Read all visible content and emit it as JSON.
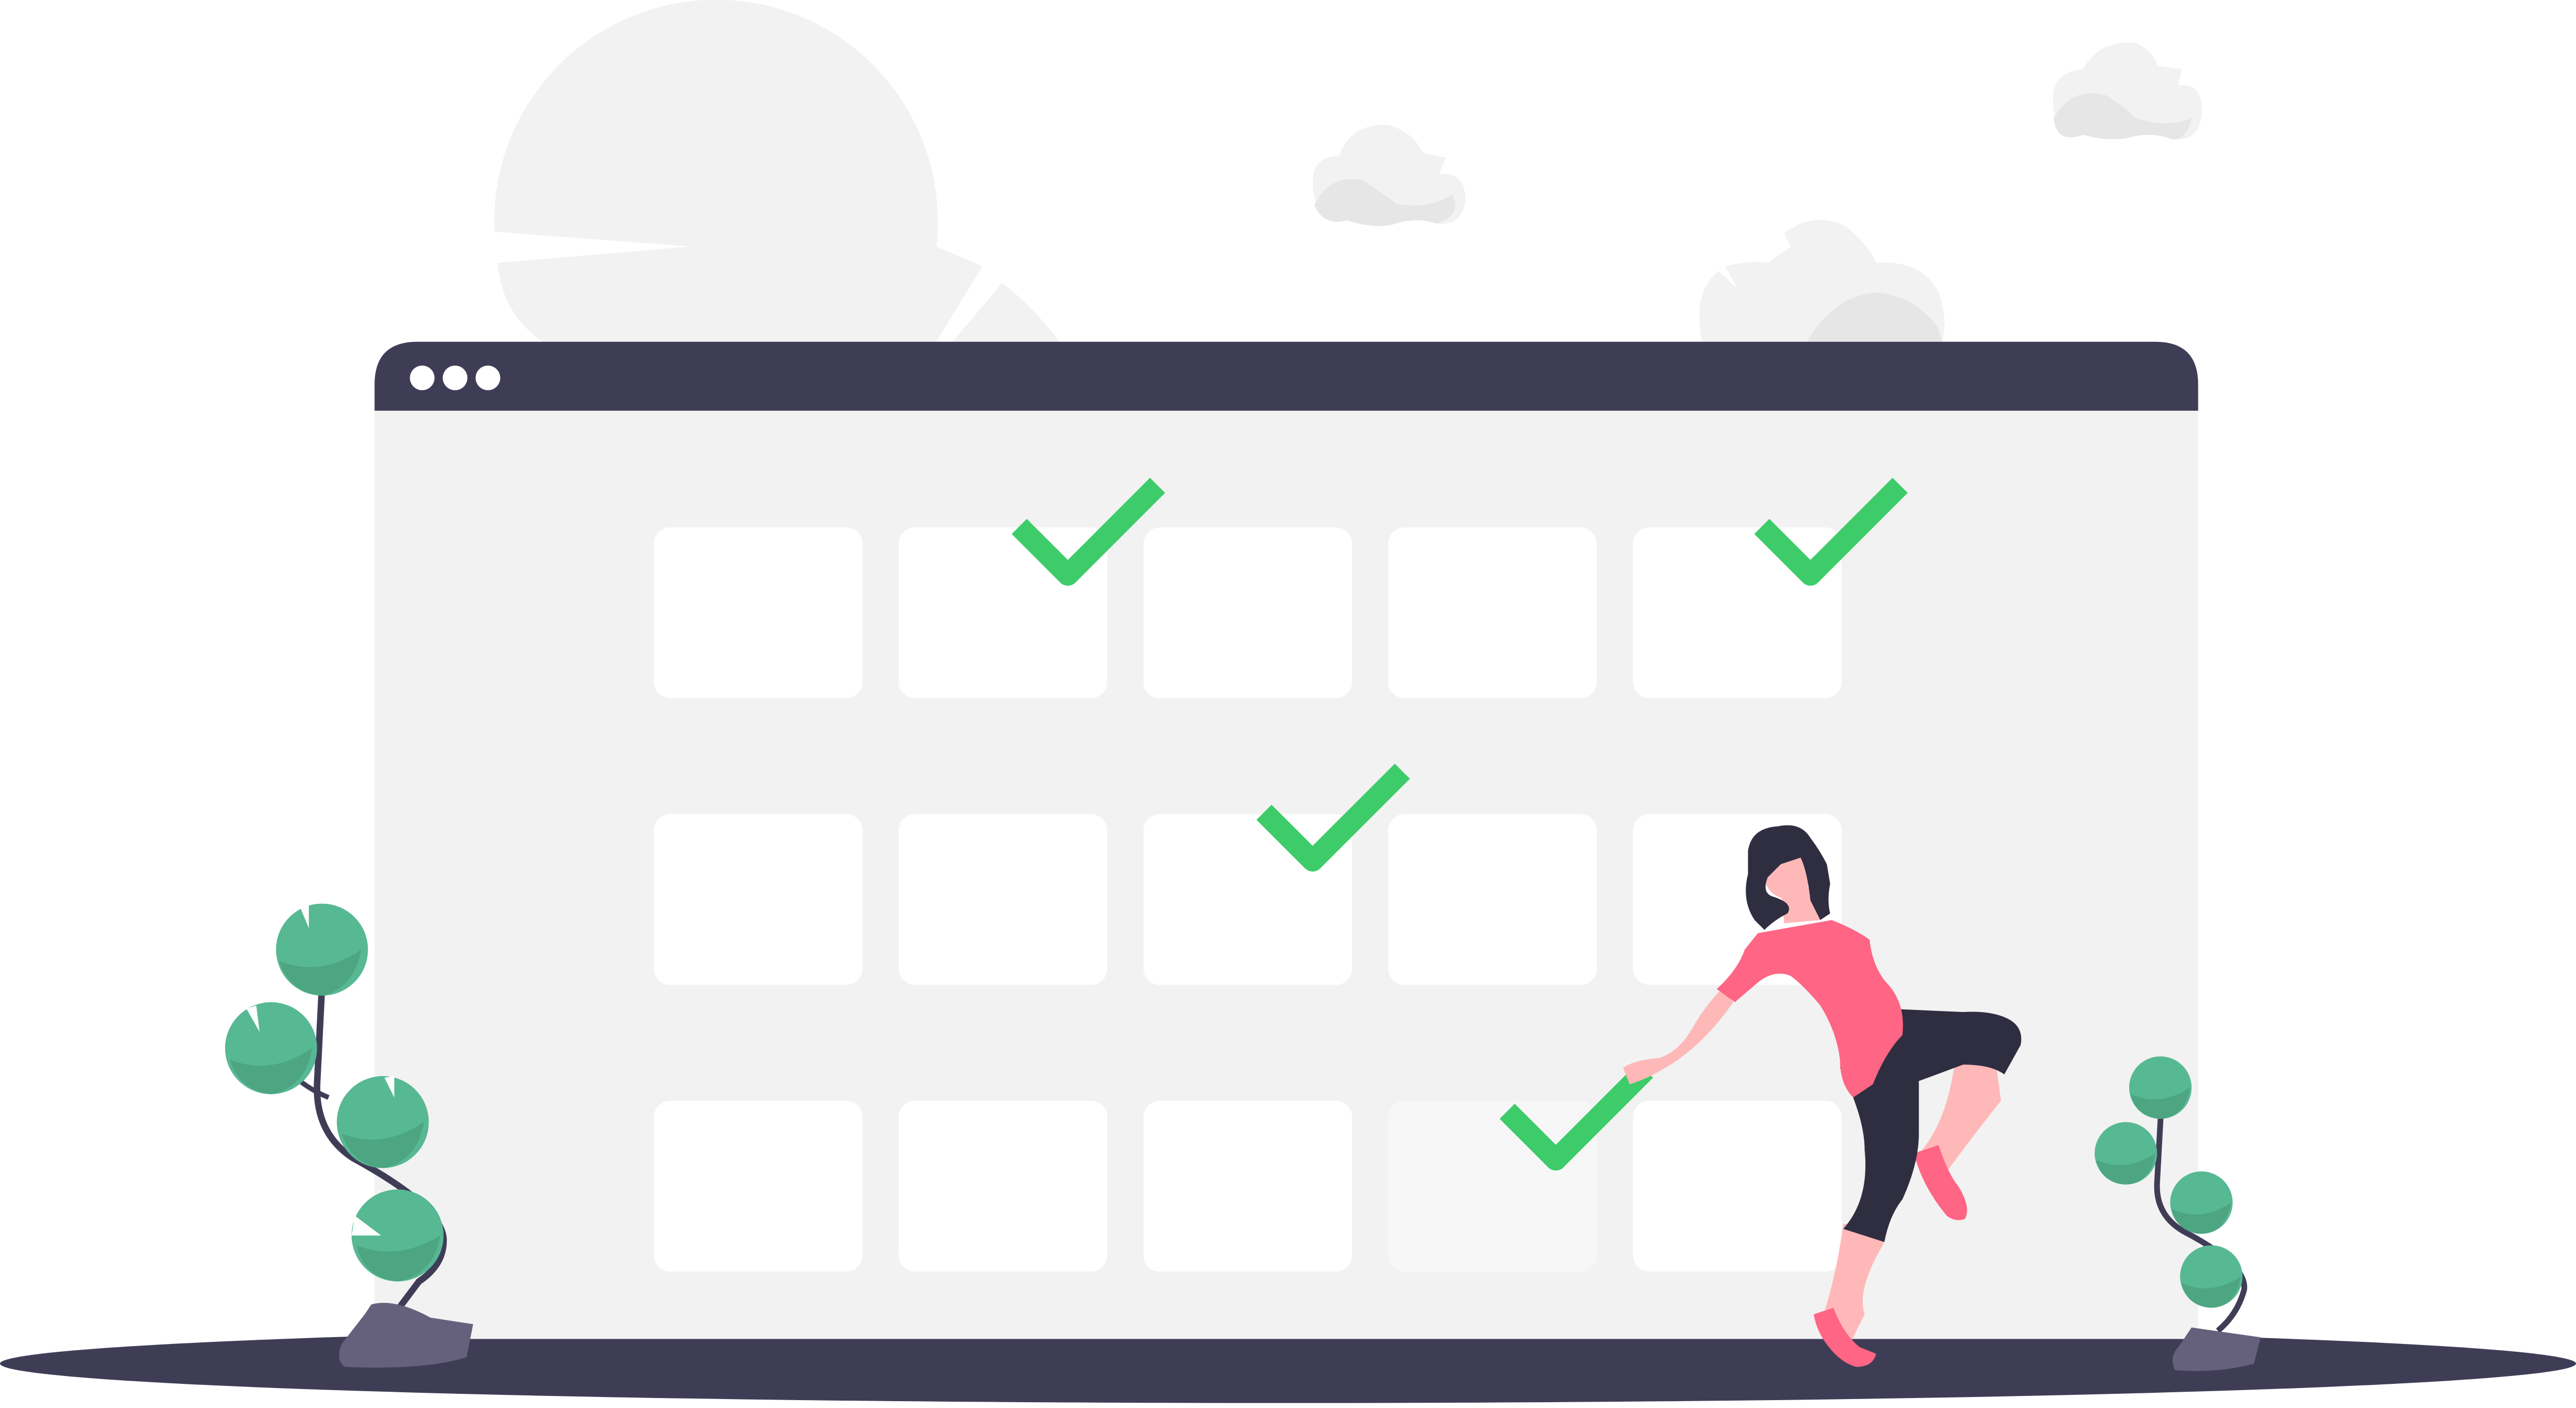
{
  "illustration": {
    "subject": "calendar-schedule",
    "colors": {
      "window_frame": "#3f3d56",
      "window_body": "#f2f2f2",
      "calendar_cell": "#ffffff",
      "calendar_cell_dimmed": "#f7f7f7",
      "window_dot": "#ffffff",
      "check": "#3ecc6b",
      "background_shape": "#f2f2f2",
      "cloud_shadow": "#e6e6e6",
      "ground": "#3f3d56",
      "plant_leaf": "#57b894",
      "plant_leaf_shade": "#4da582",
      "plant_stem": "#3f3d56",
      "plant_pot": "#65617d",
      "person_hair": "#2f2e41",
      "person_skin": "#ffb8b8",
      "person_top": "#ff6584",
      "person_pants": "#2f2e41"
    },
    "window_dots": 3,
    "calendar": {
      "rows": 3,
      "columns": 5,
      "checked_cells": [
        {
          "row": 1,
          "col": 2
        },
        {
          "row": 1,
          "col": 5
        },
        {
          "row": 2,
          "col": 3
        },
        {
          "row": 3,
          "col": 4
        }
      ],
      "dimmed_cells": [
        {
          "row": 3,
          "col": 4
        }
      ]
    }
  }
}
